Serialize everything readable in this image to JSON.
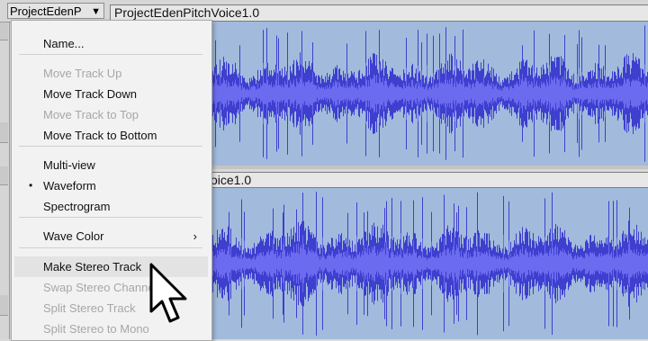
{
  "track": {
    "name_button": "ProjectEdenP",
    "clip_title": "ProjectEdenPitchVoice1.0",
    "clip_title_2": "oice1.0"
  },
  "menu": {
    "items": [
      {
        "label": "Name...",
        "enabled": true
      },
      {
        "label": "Move Track Up",
        "enabled": false
      },
      {
        "label": "Move Track Down",
        "enabled": true
      },
      {
        "label": "Move Track to Top",
        "enabled": false
      },
      {
        "label": "Move Track to Bottom",
        "enabled": true
      },
      {
        "label": "Multi-view",
        "enabled": true
      },
      {
        "label": "Waveform",
        "enabled": true,
        "selected": true
      },
      {
        "label": "Spectrogram",
        "enabled": true
      },
      {
        "label": "Wave Color",
        "enabled": true,
        "submenu": true
      },
      {
        "label": "Make Stereo Track",
        "enabled": true,
        "hovered": true
      },
      {
        "label": "Swap Stereo Channels",
        "enabled": false
      },
      {
        "label": "Split Stereo Track",
        "enabled": false
      },
      {
        "label": "Split Stereo to Mono",
        "enabled": false
      }
    ]
  },
  "colors": {
    "waveform": "#3e3ecf",
    "waveform_rms": "#6b6bef",
    "wave_background": "#a2bbdc",
    "menu_bg": "#f2f2f2",
    "disabled_text": "#a7a7a7"
  },
  "icons": {
    "dropdown": "▼",
    "submenu": "›",
    "bullet": "•",
    "cursor": "mouse-pointer-icon"
  }
}
